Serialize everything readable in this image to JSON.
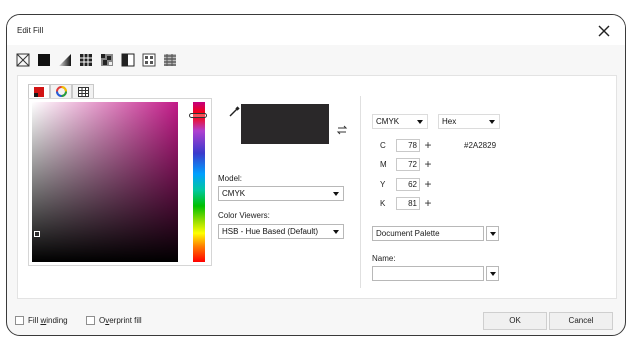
{
  "window": {
    "title": "Edit Fill"
  },
  "fill_types": [
    {
      "icon": "no-fill-icon"
    },
    {
      "icon": "uniform-fill-icon"
    },
    {
      "icon": "fountain-fill-icon"
    },
    {
      "icon": "vector-pattern-fill-icon"
    },
    {
      "icon": "bitmap-pattern-fill-icon"
    },
    {
      "icon": "two-color-pattern-fill-icon"
    },
    {
      "icon": "texture-fill-icon"
    },
    {
      "icon": "postscript-fill-icon"
    }
  ],
  "picker_tabs": [
    {
      "icon": "color-model-icon"
    },
    {
      "icon": "color-harmony-icon"
    },
    {
      "icon": "color-palette-grid-icon"
    }
  ],
  "color": {
    "hex_display": "#2A2829",
    "swatch": "#2a2829"
  },
  "model": {
    "label": "Model:",
    "value": "CMYK"
  },
  "color_viewers": {
    "label": "Color Viewers:",
    "value": "HSB - Hue Based (Default)"
  },
  "right_panel": {
    "model_value": "CMYK",
    "format_value": "Hex",
    "channels": [
      {
        "letter": "C",
        "value": "78"
      },
      {
        "letter": "M",
        "value": "72"
      },
      {
        "letter": "Y",
        "value": "62"
      },
      {
        "letter": "K",
        "value": "81"
      }
    ],
    "palette_value": "Document Palette",
    "name_label": "Name:",
    "name_value": ""
  },
  "bottom": {
    "fill_winding_prefix": "Fill ",
    "fill_winding_underlined": "w",
    "fill_winding_suffix": "inding",
    "overprint_prefix": "O",
    "overprint_underlined": "v",
    "overprint_suffix": "erprint fill",
    "ok_label": "OK",
    "cancel_label": "Cancel"
  }
}
